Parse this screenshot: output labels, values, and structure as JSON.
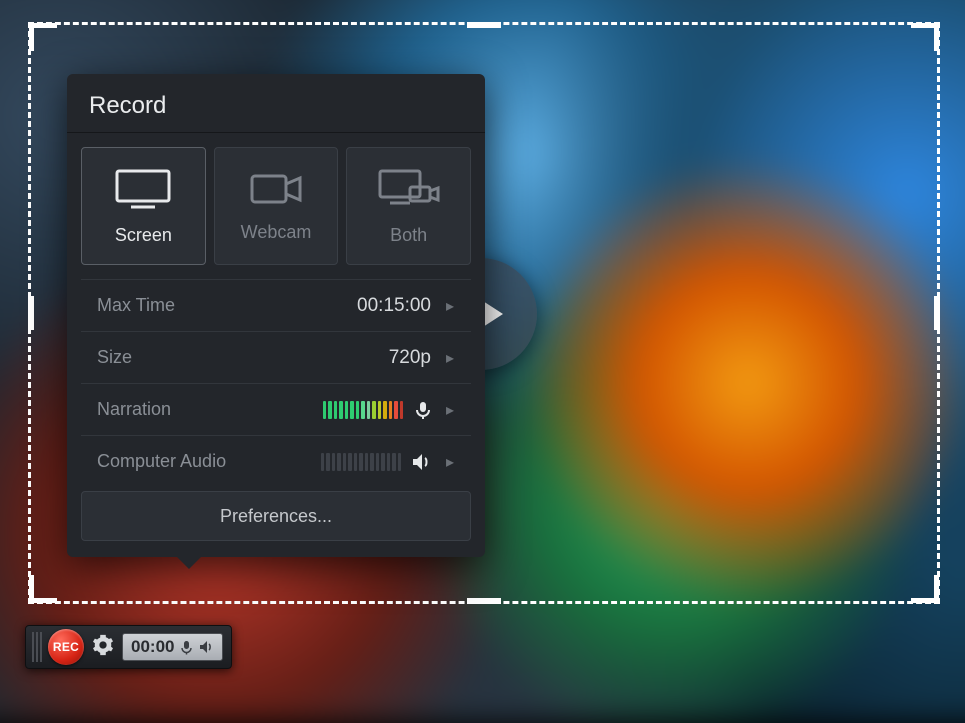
{
  "panel": {
    "title": "Record",
    "sources": {
      "screen": "Screen",
      "webcam": "Webcam",
      "both": "Both",
      "active": "screen"
    },
    "settings": {
      "maxTime": {
        "label": "Max Time",
        "value": "00:15:00"
      },
      "size": {
        "label": "Size",
        "value": "720p"
      },
      "narration": {
        "label": "Narration",
        "enabled": true
      },
      "computerAudio": {
        "label": "Computer Audio",
        "enabled": false
      }
    },
    "preferences": "Preferences..."
  },
  "toolbar": {
    "recLabel": "REC",
    "elapsed": "00:00"
  }
}
